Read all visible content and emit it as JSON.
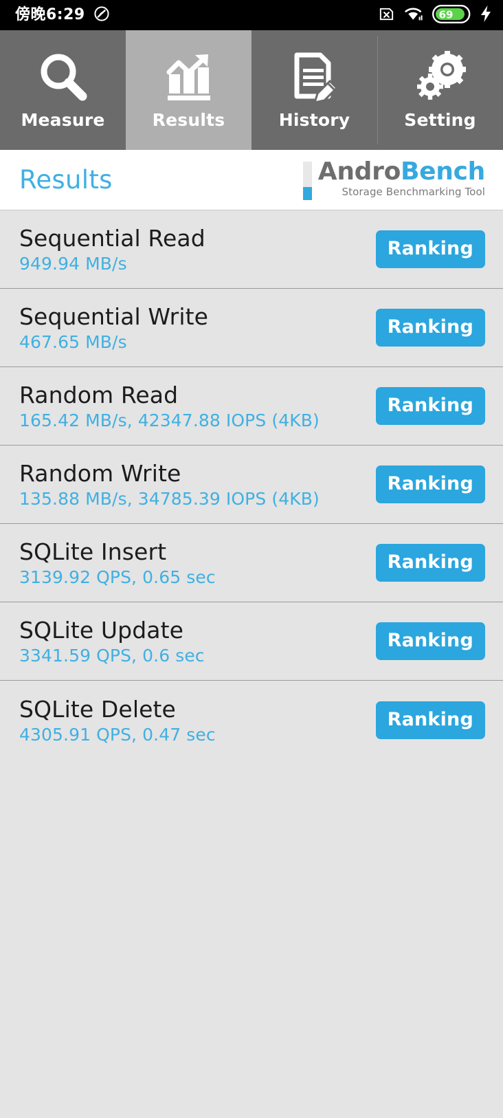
{
  "statusbar": {
    "time": "傍晚6:29",
    "silent_icon": "do-not-disturb-icon",
    "sim_icon": "no-sim-card-icon",
    "wifi_icon": "wifi-icon",
    "battery_level": "69",
    "charging_icon": "charging-bolt-icon",
    "battery_color": "#5BD24A",
    "background": "#000000"
  },
  "tabs": [
    {
      "label": "Measure",
      "icon": "magnifier-icon",
      "active": false
    },
    {
      "label": "Results",
      "icon": "bar-chart-arrow-icon",
      "active": true
    },
    {
      "label": "History",
      "icon": "document-pencil-icon",
      "active": false
    },
    {
      "label": "Setting",
      "icon": "gears-icon",
      "active": false
    }
  ],
  "header": {
    "title": "Results",
    "brand_prefix": "Andro",
    "brand_suffix": "Bench",
    "brand_subtitle": "Storage Benchmarking Tool",
    "title_color": "#3FB0E3",
    "brand_prefix_color": "#6E6E6E",
    "brand_suffix_color": "#36A9DF"
  },
  "results": [
    {
      "name": "Sequential Read",
      "value": "949.94 MB/s",
      "button": "Ranking"
    },
    {
      "name": "Sequential Write",
      "value": "467.65 MB/s",
      "button": "Ranking"
    },
    {
      "name": "Random Read",
      "value": "165.42 MB/s, 42347.88 IOPS (4KB)",
      "button": "Ranking"
    },
    {
      "name": "Random Write",
      "value": "135.88 MB/s, 34785.39 IOPS (4KB)",
      "button": "Ranking"
    },
    {
      "name": "SQLite Insert",
      "value": "3139.92 QPS, 0.65 sec",
      "button": "Ranking"
    },
    {
      "name": "SQLite Update",
      "value": "3341.59 QPS, 0.6 sec",
      "button": "Ranking"
    },
    {
      "name": "SQLite Delete",
      "value": "4305.91 QPS, 0.47 sec",
      "button": "Ranking"
    }
  ],
  "colors": {
    "accent": "#2BA6DE",
    "tab_inactive": "#6B6B6B",
    "tab_active": "#AFAFAF",
    "list_background": "#E4E4E4",
    "row_divider": "#9A9A9A"
  }
}
